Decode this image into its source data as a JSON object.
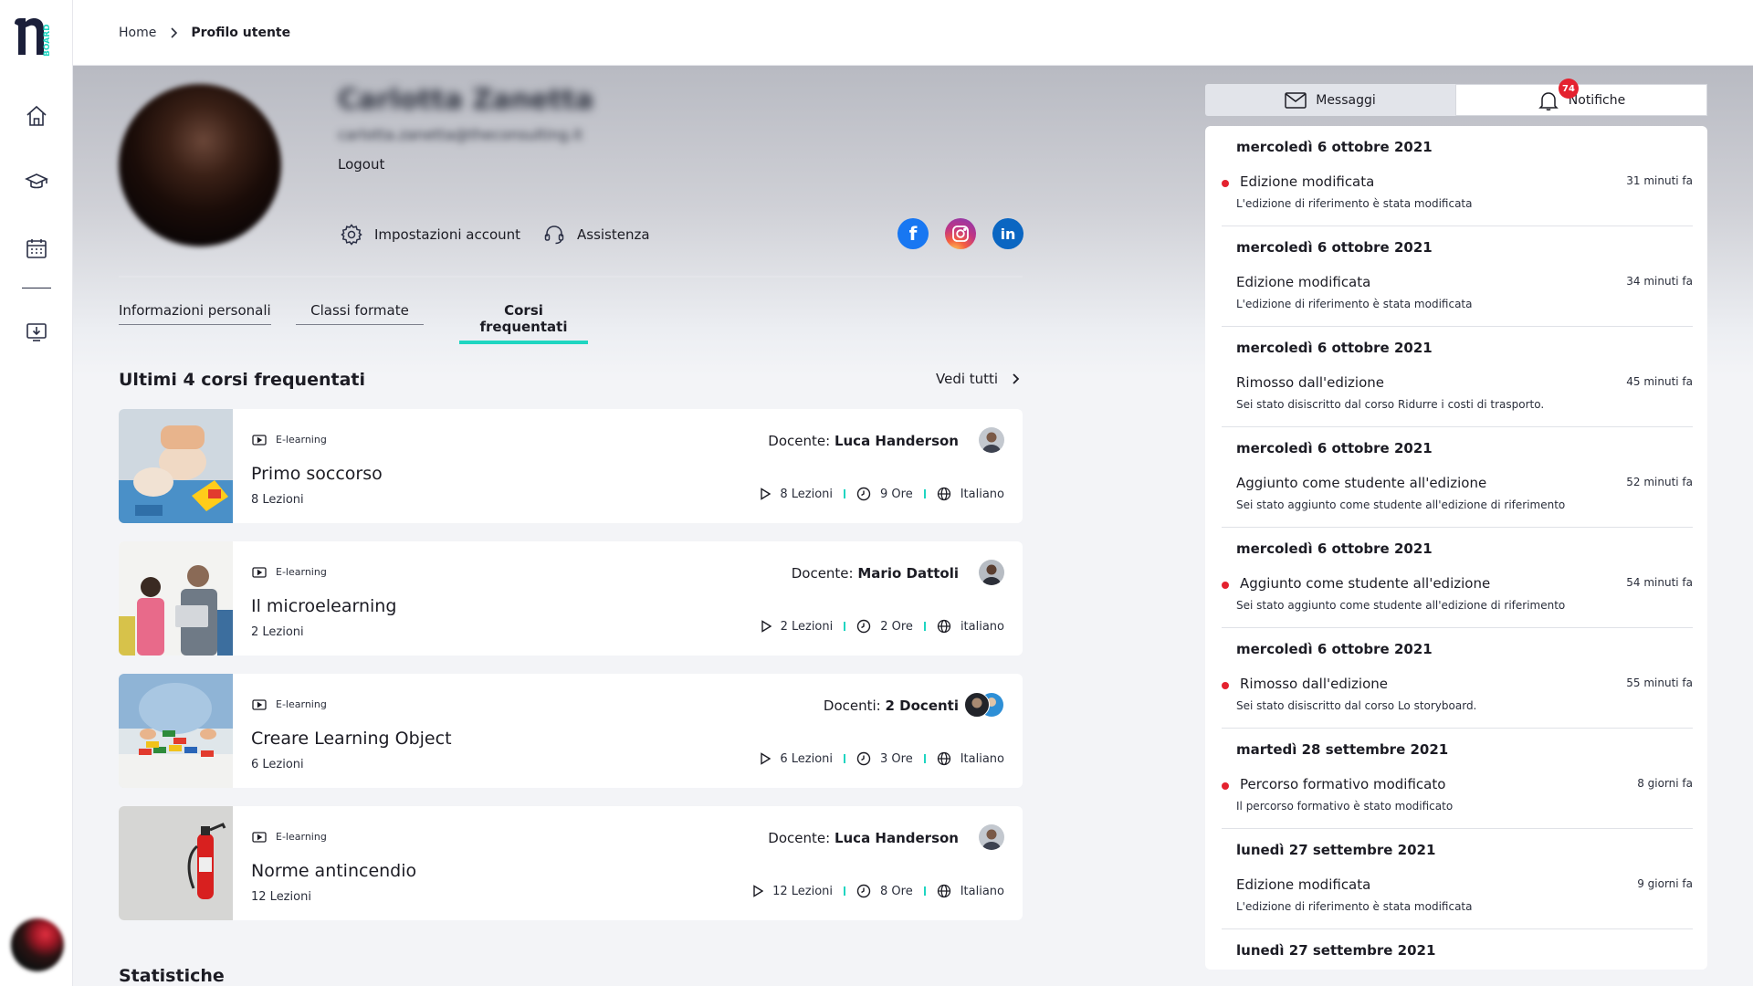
{
  "sidebar": {
    "logo_text": "BOARD",
    "items": [
      {
        "icon": "home-icon"
      },
      {
        "icon": "graduation-cap-icon"
      },
      {
        "icon": "calendar-icon"
      },
      {
        "icon": "download-monitor-icon"
      }
    ]
  },
  "breadcrumb": {
    "home": "Home",
    "current": "Profilo utente"
  },
  "profile": {
    "name": "Carlotta Zanetta",
    "email": "carlotta.zanetta@theconsulting.it",
    "logout": "Logout",
    "settings_label": "Impostazioni account",
    "support_label": "Assistenza",
    "social": {
      "facebook": "f",
      "instagram": "instagram",
      "linkedin": "in"
    }
  },
  "tabs": [
    {
      "label": "Informazioni personali"
    },
    {
      "label": "Classi formate"
    },
    {
      "label": "Corsi frequentati",
      "active": true
    }
  ],
  "courses_section": {
    "title": "Ultimi 4 corsi frequentati",
    "see_all": "Vedi tutti"
  },
  "courses": [
    {
      "type": "E-learning",
      "title": "Primo soccorso",
      "lessons_text": "8 Lezioni",
      "teacher_prefix": "Docente: ",
      "teacher_name": "Luca Handerson",
      "meta_lessons": "8 Lezioni",
      "meta_hours": "9 Ore",
      "meta_language": "Italiano"
    },
    {
      "type": "E-learning",
      "title": "Il microelearning",
      "lessons_text": "2 Lezioni",
      "teacher_prefix": "Docente: ",
      "teacher_name": "Mario Dattoli",
      "meta_lessons": "2 Lezioni",
      "meta_hours": "2 Ore",
      "meta_language": "italiano"
    },
    {
      "type": "E-learning",
      "title": "Creare Learning Object",
      "lessons_text": "6 Lezioni",
      "teacher_prefix": "Docenti: ",
      "teacher_name": "2 Docenti",
      "meta_lessons": "6 Lezioni",
      "meta_hours": "3 Ore",
      "meta_language": "Italiano"
    },
    {
      "type": "E-learning",
      "title": "Norme antincendio",
      "lessons_text": "12 Lezioni",
      "teacher_prefix": "Docente: ",
      "teacher_name": "Luca Handerson",
      "meta_lessons": "12 Lezioni",
      "meta_hours": "8 Ore",
      "meta_language": "Italiano"
    }
  ],
  "stats_title": "Statistiche",
  "panel": {
    "messages_label": "Messaggi",
    "notifications_label": "Notifiche",
    "notifications_badge": "74"
  },
  "notifications": [
    {
      "date": "mercoledì 6 ottobre 2021",
      "title": "Edizione modificata",
      "desc": "L'edizione di riferimento è stata modificata",
      "time": "31 minuti fa",
      "unread": true
    },
    {
      "date": "mercoledì 6 ottobre 2021",
      "title": "Edizione modificata",
      "desc": "L'edizione di riferimento è stata modificata",
      "time": "34 minuti fa",
      "unread": false
    },
    {
      "date": "mercoledì 6 ottobre 2021",
      "title": "Rimosso dall'edizione",
      "desc": "Sei stato disiscritto dal corso Ridurre i costi di trasporto.",
      "time": "45 minuti fa",
      "unread": false
    },
    {
      "date": "mercoledì 6 ottobre 2021",
      "title": "Aggiunto come studente all'edizione",
      "desc": "Sei stato aggiunto come studente all'edizione di riferimento",
      "time": "52 minuti fa",
      "unread": false
    },
    {
      "date": "mercoledì 6 ottobre 2021",
      "title": "Aggiunto come studente all'edizione",
      "desc": "Sei stato aggiunto come studente all'edizione di riferimento",
      "time": "54 minuti fa",
      "unread": true
    },
    {
      "date": "mercoledì 6 ottobre 2021",
      "title": "Rimosso dall'edizione",
      "desc": "Sei stato disiscritto dal corso Lo storyboard.",
      "time": "55 minuti fa",
      "unread": true
    },
    {
      "date": "martedì 28 settembre 2021",
      "title": "Percorso formativo modificato",
      "desc": "Il percorso formativo è stato modificato",
      "time": "8 giorni fa",
      "unread": true
    },
    {
      "date": "lunedì 27 settembre 2021",
      "title": "Edizione modificata",
      "desc": "L'edizione di riferimento è stata modificata",
      "time": "9 giorni fa",
      "unread": false
    },
    {
      "date": "lunedì 27 settembre 2021",
      "title": "",
      "desc": "",
      "time": "",
      "unread": false
    }
  ],
  "colors": {
    "accent": "#1fd5c1",
    "unread_dot": "#e4222f",
    "facebook": "#1877f2",
    "linkedin": "#0a66c2"
  }
}
